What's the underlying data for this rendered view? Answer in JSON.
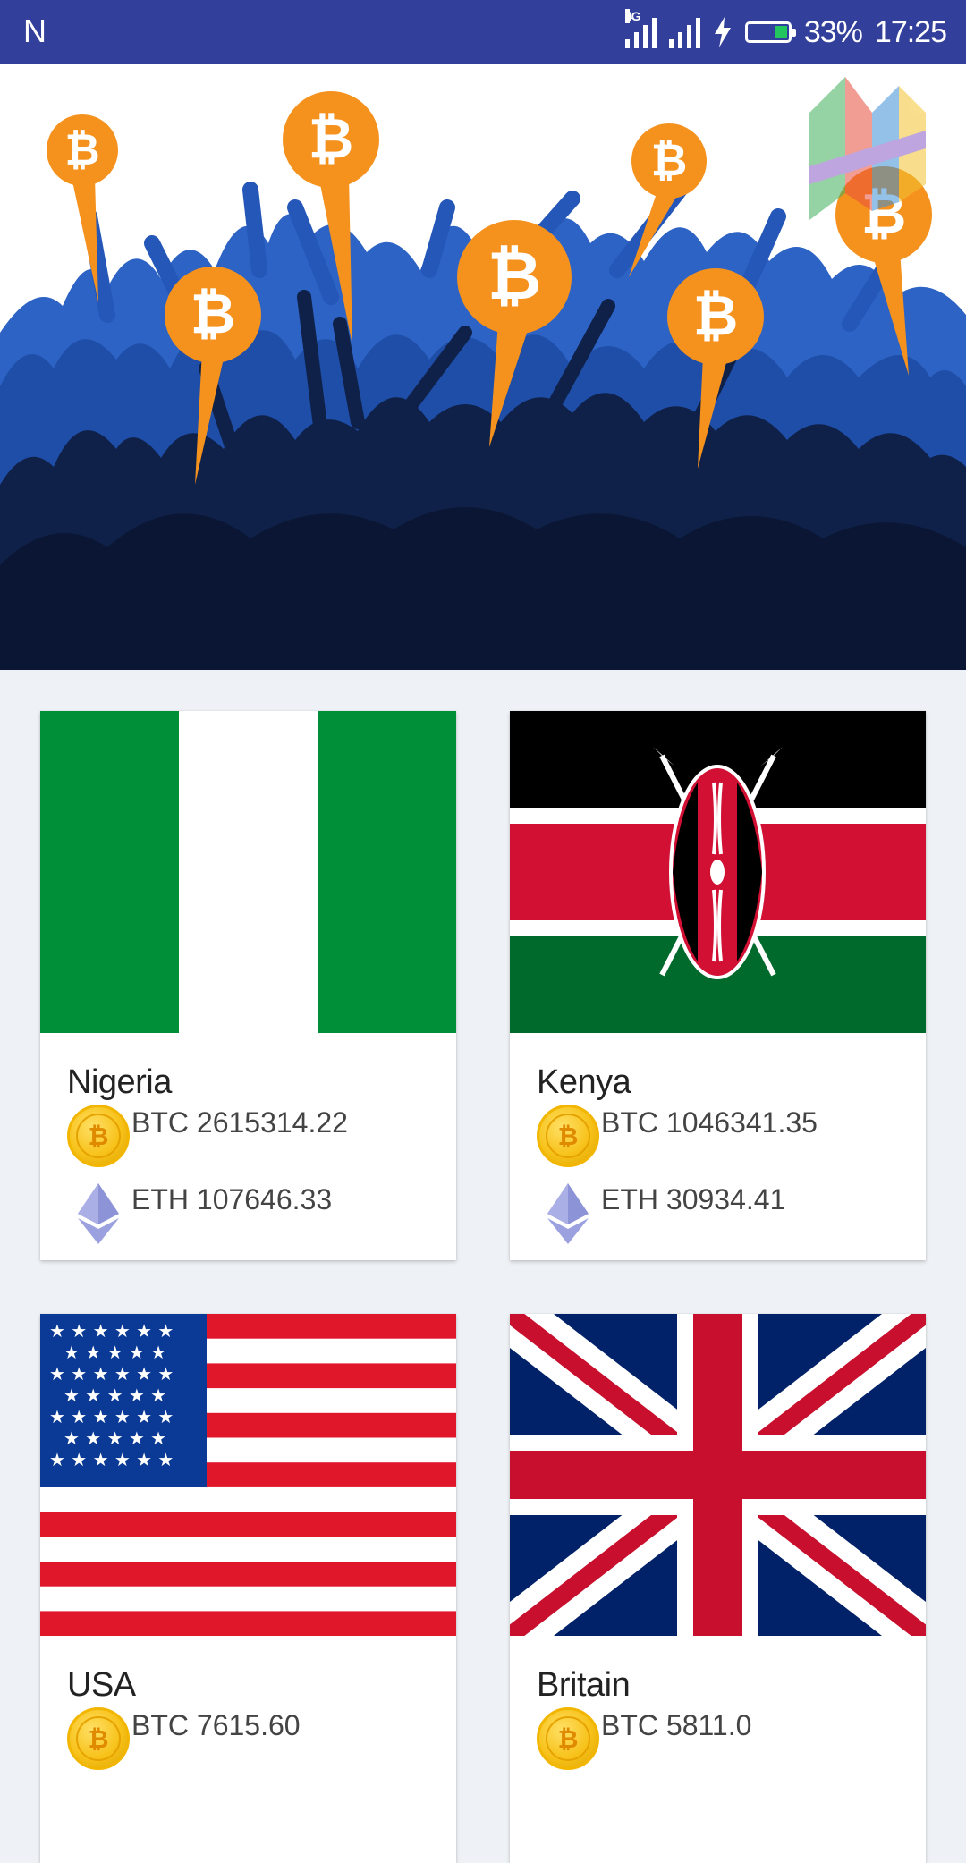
{
  "status_bar": {
    "app_indicator": "N",
    "network": "4G",
    "battery_percent": "33%",
    "time": "17:25"
  },
  "banner": {
    "accent_orange": "#f5921e",
    "crowd_dark": "#0c1a3a",
    "crowd_blue": "#2457b8"
  },
  "cards": [
    {
      "country": "Nigeria",
      "btc": "BTC 2615314.22",
      "eth": "ETH 107646.33",
      "flag_icon": "nigeria-flag"
    },
    {
      "country": "Kenya",
      "btc": "BTC 1046341.35",
      "eth": "ETH 30934.41",
      "flag_icon": "kenya-flag"
    },
    {
      "country": "USA",
      "btc": "BTC 7615.60",
      "eth": "",
      "flag_icon": "usa-flag"
    },
    {
      "country": "Britain",
      "btc": "BTC 5811.0",
      "eth": "",
      "flag_icon": "britain-flag"
    }
  ]
}
